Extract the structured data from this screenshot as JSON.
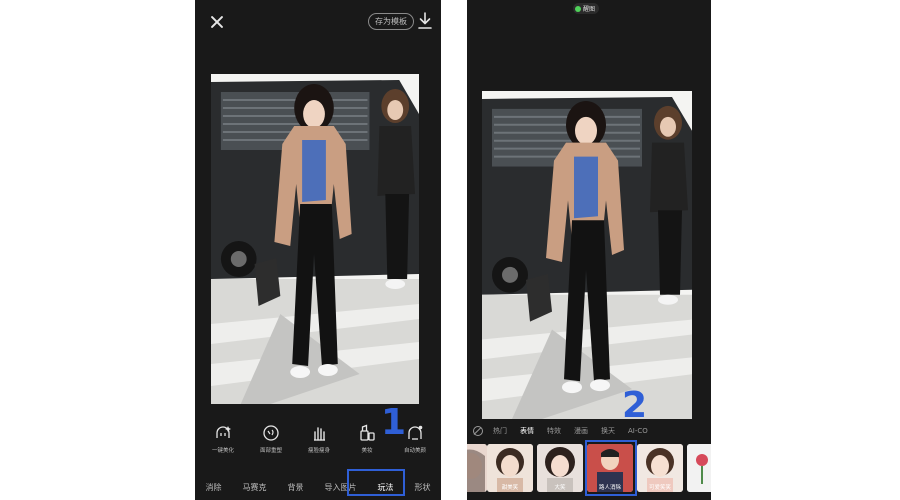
{
  "left_screen": {
    "template_button": "存为模板",
    "tools": [
      {
        "label": "一键美化",
        "icon": "face-sparkle-icon"
      },
      {
        "label": "面部重塑",
        "icon": "face-reshape-icon"
      },
      {
        "label": "瘦脸瘦身",
        "icon": "hand-slim-icon"
      },
      {
        "label": "美妆",
        "icon": "makeup-icon"
      },
      {
        "label": "自动美颜",
        "icon": "auto-beauty-icon"
      }
    ],
    "nav": [
      "消除",
      "马赛克",
      "背景",
      "导入图片",
      "玩法",
      "形状"
    ],
    "nav_active": "玩法"
  },
  "right_screen": {
    "app_tag": "醒图",
    "categories": [
      "热门",
      "表情",
      "特效",
      "漫画",
      "换天",
      "AI-CO"
    ],
    "category_active": "表情",
    "thumbnails": [
      {
        "label": ""
      },
      {
        "label": "甜美笑"
      },
      {
        "label": "大笑"
      },
      {
        "label": "路人消除"
      },
      {
        "label": ""
      },
      {
        "label": "可爱笑笑"
      },
      {
        "label": ""
      }
    ]
  },
  "annotations": {
    "step1": "1",
    "step2": "2",
    "color": "#2f5fd6"
  },
  "colors": {
    "phone_bg": "#191919",
    "text_muted": "#bdbdbd"
  }
}
